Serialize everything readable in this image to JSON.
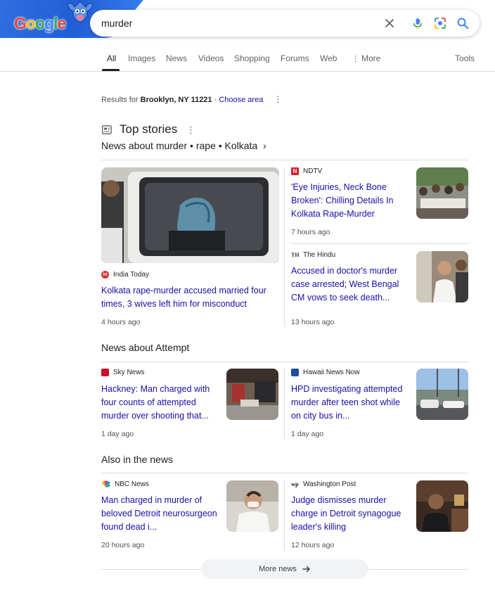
{
  "header": {
    "doodle_letters": [
      "G",
      "o",
      "o",
      "g",
      "l",
      "e"
    ],
    "search_value": "murder"
  },
  "tabs": [
    {
      "label": "All"
    },
    {
      "label": "Images"
    },
    {
      "label": "News"
    },
    {
      "label": "Videos"
    },
    {
      "label": "Shopping"
    },
    {
      "label": "Forums"
    },
    {
      "label": "Web"
    },
    {
      "label": "More"
    },
    {
      "label": "Tools"
    }
  ],
  "location": {
    "prefix": "Results for ",
    "place": "Brooklyn, NY 11221",
    "separator": " · ",
    "link": "Choose area"
  },
  "top_stories": {
    "title": "Top stories",
    "subtitle": "News about murder • rape • Kolkata"
  },
  "stories": {
    "featured": {
      "source": "India Today",
      "headline": "Kolkata rape-murder accused married four times, 3 wives left him for misconduct",
      "time": "4 hours ago"
    },
    "ndtv": {
      "source": "NDTV",
      "headline": "'Eye Injuries, Neck Bone Broken': Chilling Details In Kolkata Rape-Murder",
      "time": "7 hours ago"
    },
    "hindu": {
      "source": "The Hindu",
      "headline": "Accused in doctor's murder case arrested; West Bengal CM vows to seek death...",
      "time": "13 hours ago"
    }
  },
  "attempt": {
    "title": "News about Attempt",
    "left": {
      "source": "Sky News",
      "headline": "Hackney: Man charged with four counts of attempted murder over shooting that...",
      "time": "1 day ago"
    },
    "right": {
      "source": "Hawaii News Now",
      "headline": "HPD investigating attempted murder after teen shot while on city bus in...",
      "time": "1 day ago"
    }
  },
  "also": {
    "title": "Also in the news",
    "left": {
      "source": "NBC News",
      "headline": "Man charged in murder of beloved Detroit neurosurgeon found dead i...",
      "time": "20 hours ago"
    },
    "right": {
      "source": "Washington Post",
      "headline": "Judge dismisses murder charge in Detroit synagogue leader's killing",
      "time": "12 hours ago"
    }
  },
  "more_news": "More news",
  "icons": {
    "clear": "close-icon",
    "voice": "mic-icon",
    "lens": "camera-lens-icon",
    "search": "search-icon"
  },
  "colors": {
    "link": "#1a0dab",
    "text": "#202124",
    "muted": "#4d5156",
    "divider": "#dadce0",
    "doodle_blue": "#2f6fe0"
  }
}
